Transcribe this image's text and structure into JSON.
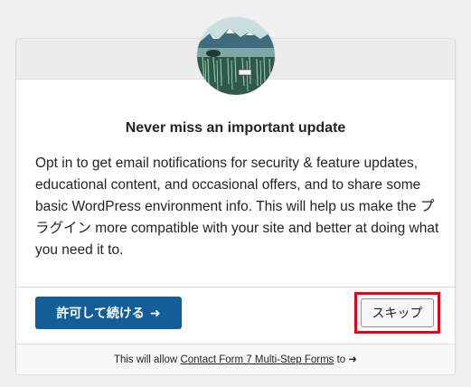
{
  "dialog": {
    "title": "Never miss an important update",
    "description": "Opt in to get email notifications for security & feature updates, educational content, and occasional offers, and to share some basic WordPress environment info. This will help us make the プラグイン more compatible with your site and better at doing what you need it to.",
    "avatar_icon": "plugin-landscape-icon"
  },
  "actions": {
    "allow_label": "許可して続ける",
    "allow_arrow": "➜",
    "skip_label": "スキップ",
    "highlight_color": "#e60012"
  },
  "footer": {
    "prefix": "This will allow ",
    "plugin_link": "Contact Form 7 Multi-Step Forms",
    "suffix": " to ",
    "arrow": "➜"
  },
  "colors": {
    "primary_button": "#135e96",
    "background": "#f0f0f1"
  }
}
